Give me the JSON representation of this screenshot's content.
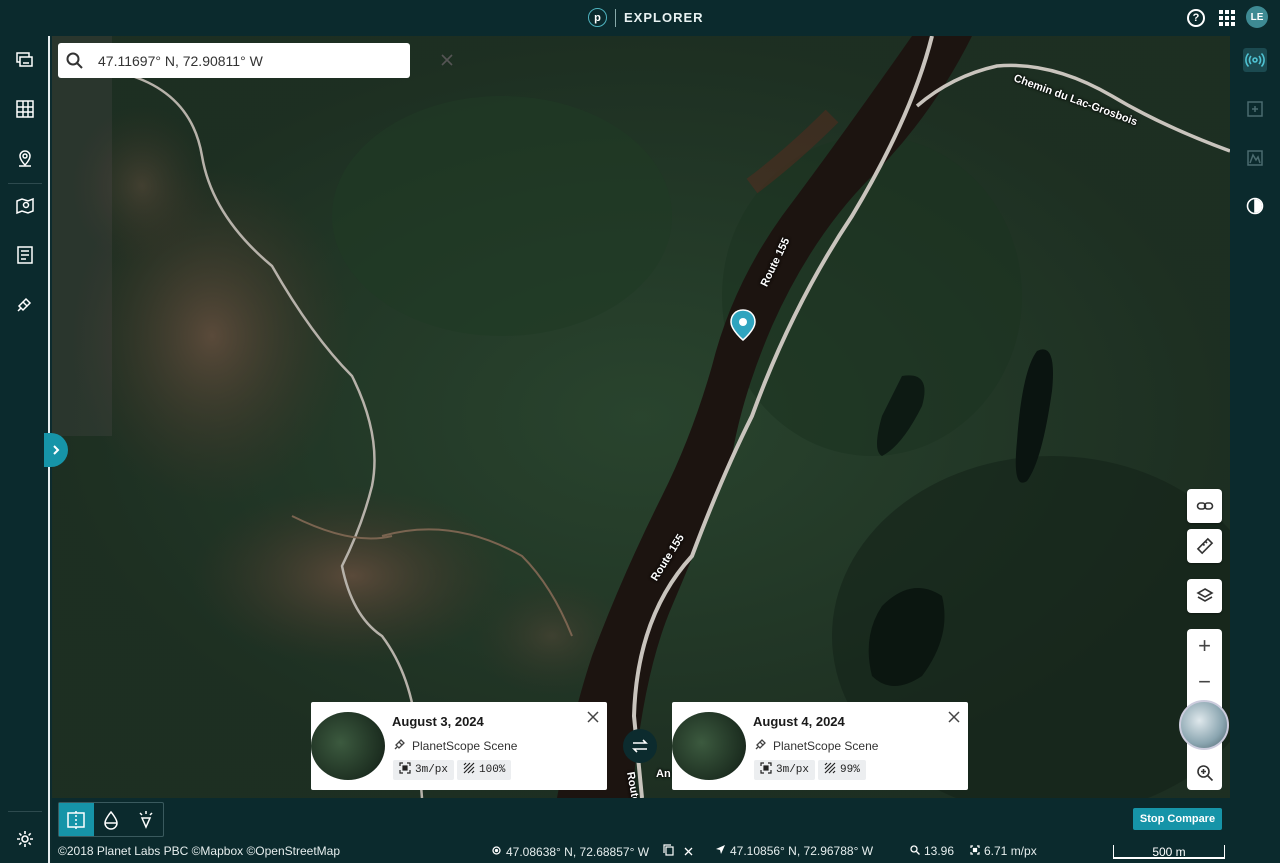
{
  "header": {
    "logo_letter": "p",
    "title": "EXPLORER",
    "avatar_initials": "LE"
  },
  "search": {
    "value": "47.11697° N, 72.90811° W"
  },
  "map_labels": {
    "road_north": "Chemin du Lac-Grosbois",
    "route_upper": "Route 155",
    "route_lower": "Route 155",
    "route_bottom": "Route",
    "partial_label": "An"
  },
  "compare": {
    "left": {
      "date": "August 3, 2024",
      "type": "PlanetScope Scene",
      "resolution": "3m/px",
      "coverage": "100%"
    },
    "right": {
      "date": "August 4, 2024",
      "type": "PlanetScope Scene",
      "resolution": "3m/px",
      "coverage": "99%"
    },
    "stop_label": "Stop Compare"
  },
  "status_bar": {
    "attribution": "©2018 Planet Labs PBC ©Mapbox ©OpenStreetMap",
    "cursor_coords": "47.08638° N, 72.68857° W",
    "pin_coords": "47.10856° N, 72.96788° W",
    "zoom": "13.96",
    "resolution": "6.71 m/px",
    "scale": "500 m"
  },
  "colors": {
    "accent": "#1694a8",
    "chrome": "#0b2a2d"
  }
}
